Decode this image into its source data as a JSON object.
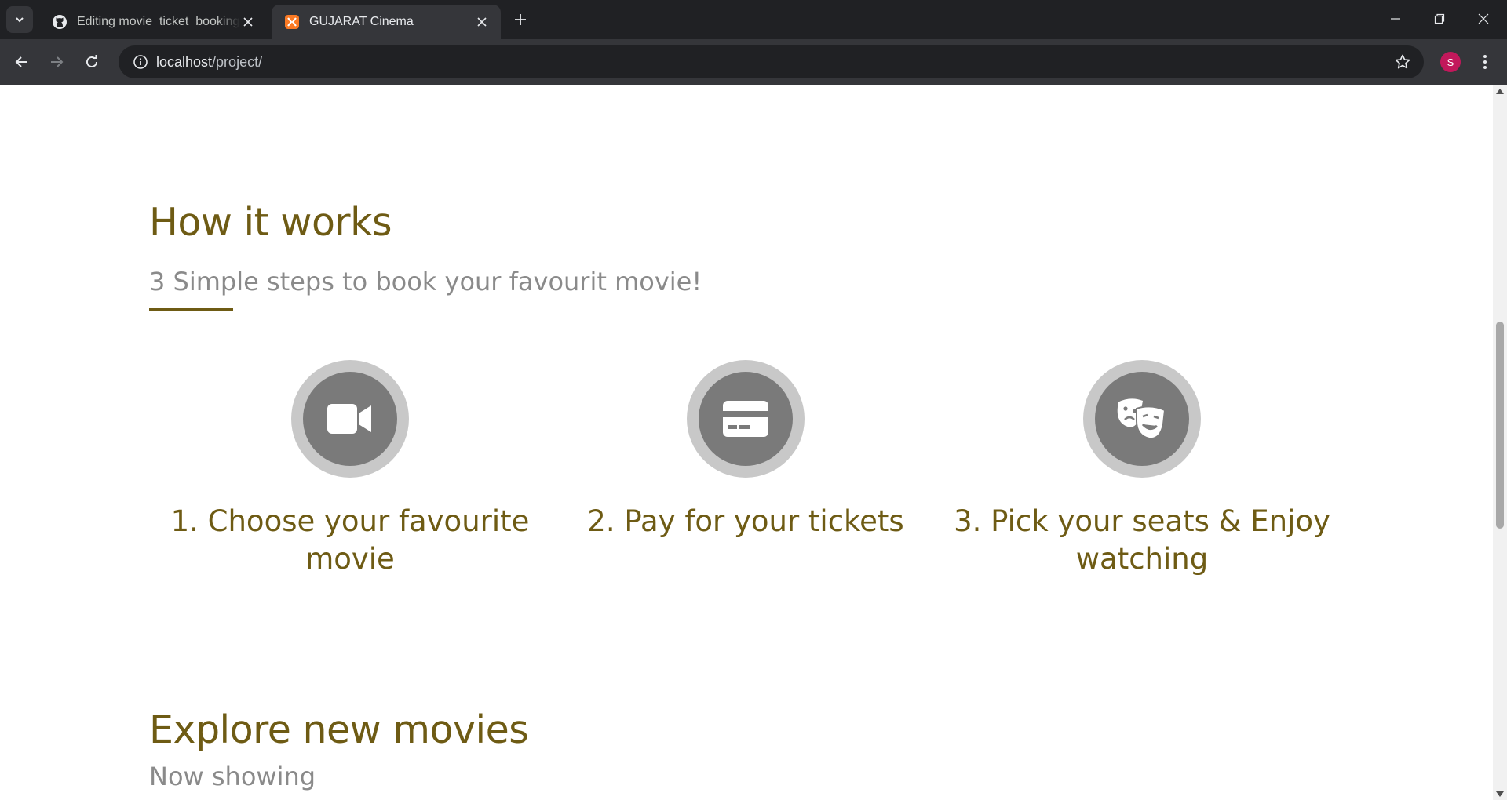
{
  "browser": {
    "tabs": [
      {
        "title": "Editing movie_ticket_booking/R",
        "active": false,
        "icon": "github-icon"
      },
      {
        "title": "GUJARAT Cinema",
        "active": true,
        "icon": "xampp-icon"
      }
    ],
    "url_host": "localhost",
    "url_path": "/project/",
    "profile_initial": "S",
    "colors": {
      "profile": "#c2185b",
      "chrome_dark": "#202124",
      "chrome_mid": "#35363a"
    }
  },
  "how_it_works": {
    "title": "How it works",
    "subtitle": "3 Simple steps to book your favourit movie!",
    "steps": [
      {
        "label": "1. Choose your favourite movie",
        "icon": "video-camera-icon"
      },
      {
        "label": "2. Pay for your tickets",
        "icon": "credit-card-icon"
      },
      {
        "label": "3. Pick your seats & Enjoy watching",
        "icon": "theater-masks-icon"
      }
    ]
  },
  "explore": {
    "title": "Explore new movies",
    "subtitle": "Now showing"
  },
  "theme": {
    "accent": "#6e5b14",
    "muted": "#8a8a8a",
    "icon_ring": "#c8c8c8",
    "icon_fill": "#7a7a7a"
  }
}
